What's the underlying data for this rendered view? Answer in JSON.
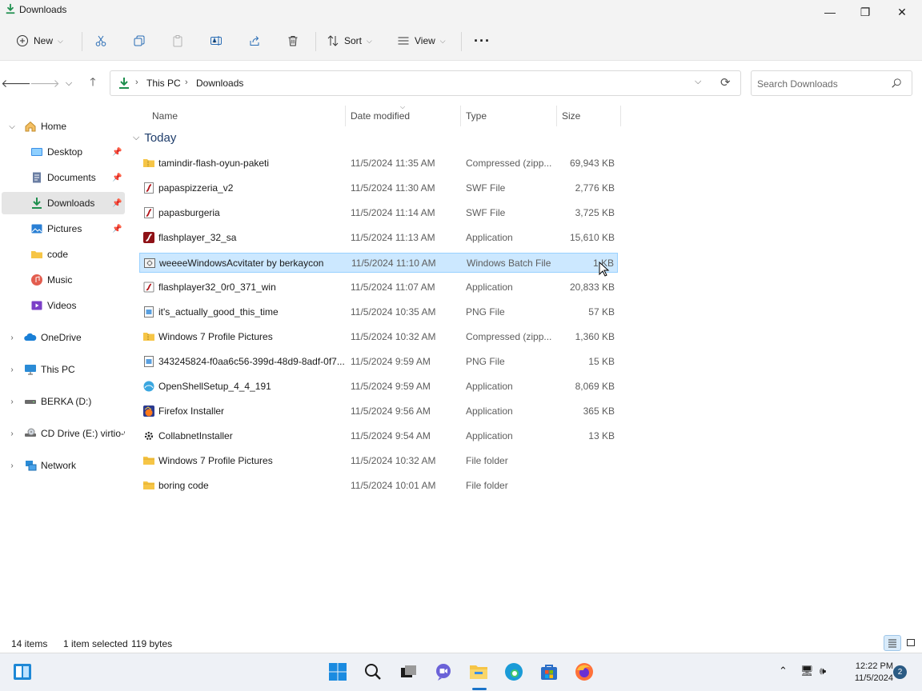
{
  "window": {
    "title": "Downloads",
    "controls": {
      "minimize": "—",
      "maximize": "❐",
      "close": "✕"
    }
  },
  "toolbar": {
    "new_label": "New",
    "sort_label": "Sort",
    "view_label": "View",
    "more_label": "···",
    "icons": [
      "cut-icon",
      "copy-icon",
      "paste-icon",
      "rename-icon",
      "share-icon",
      "delete-icon"
    ]
  },
  "address": {
    "crumbs": [
      "This PC",
      "Downloads"
    ],
    "separator": "›"
  },
  "search": {
    "placeholder": "Search Downloads"
  },
  "sidebar": {
    "items": [
      {
        "label": "Home",
        "icon": "home-icon",
        "chevron": "expanded"
      },
      {
        "label": "Desktop",
        "icon": "desktop-icon",
        "pinned": true
      },
      {
        "label": "Documents",
        "icon": "documents-icon",
        "pinned": true
      },
      {
        "label": "Downloads",
        "icon": "download-icon",
        "pinned": true,
        "selected": true
      },
      {
        "label": "Pictures",
        "icon": "pictures-icon",
        "pinned": true
      },
      {
        "label": "code",
        "icon": "folder-icon"
      },
      {
        "label": "Music",
        "icon": "music-icon"
      },
      {
        "label": "Videos",
        "icon": "videos-icon"
      },
      {
        "label": "OneDrive",
        "icon": "onedrive-icon",
        "chevron": "collapsed"
      },
      {
        "label": "This PC",
        "icon": "this-pc-icon",
        "chevron": "collapsed"
      },
      {
        "label": "BERKA (D:)",
        "icon": "drive-icon",
        "chevron": "collapsed"
      },
      {
        "label": "CD Drive (E:) virtio-w",
        "icon": "cd-drive-icon",
        "chevron": "collapsed"
      },
      {
        "label": "Network",
        "icon": "network-icon",
        "chevron": "collapsed"
      }
    ]
  },
  "columns": {
    "name": "Name",
    "date": "Date modified",
    "type": "Type",
    "size": "Size"
  },
  "group": {
    "label": "Today"
  },
  "files": [
    {
      "name": "tamindir-flash-oyun-paketi",
      "date": "11/5/2024 11:35 AM",
      "type": "Compressed (zipp...",
      "size": "69,943 KB",
      "icon": "zip-folder-icon"
    },
    {
      "name": "papaspizzeria_v2",
      "date": "11/5/2024 11:30 AM",
      "type": "SWF File",
      "size": "2,776 KB",
      "icon": "swf-file-icon"
    },
    {
      "name": "papasburgeria",
      "date": "11/5/2024 11:14 AM",
      "type": "SWF File",
      "size": "3,725 KB",
      "icon": "swf-file-icon"
    },
    {
      "name": "flashplayer_32_sa",
      "date": "11/5/2024 11:13 AM",
      "type": "Application",
      "size": "15,610 KB",
      "icon": "flash-app-icon"
    },
    {
      "name": "weeeeWindowsAcvitater by berkaycon",
      "date": "11/5/2024 11:10 AM",
      "type": "Windows Batch File",
      "size": "1 KB",
      "icon": "batch-file-icon",
      "selected": true
    },
    {
      "name": "flashplayer32_0r0_371_win",
      "date": "11/5/2024 11:07 AM",
      "type": "Application",
      "size": "20,833 KB",
      "icon": "flash-app-icon"
    },
    {
      "name": "it's_actually_good_this_time",
      "date": "11/5/2024 10:35 AM",
      "type": "PNG File",
      "size": "57 KB",
      "icon": "png-file-icon"
    },
    {
      "name": "Windows 7 Profile Pictures",
      "date": "11/5/2024 10:32 AM",
      "type": "Compressed (zipp...",
      "size": "1,360 KB",
      "icon": "zip-folder-icon"
    },
    {
      "name": "343245824-f0aa6c56-399d-48d9-8adf-0f7...",
      "date": "11/5/2024 9:59 AM",
      "type": "PNG File",
      "size": "15 KB",
      "icon": "png-file-icon"
    },
    {
      "name": "OpenShellSetup_4_4_191",
      "date": "11/5/2024 9:59 AM",
      "type": "Application",
      "size": "8,069 KB",
      "icon": "openshell-icon"
    },
    {
      "name": "Firefox Installer",
      "date": "11/5/2024 9:56 AM",
      "type": "Application",
      "size": "365 KB",
      "icon": "firefox-installer-icon"
    },
    {
      "name": "CollabnetInstaller",
      "date": "11/5/2024 9:54 AM",
      "type": "Application",
      "size": "13 KB",
      "icon": "installer-icon"
    },
    {
      "name": "Windows 7 Profile Pictures",
      "date": "11/5/2024 10:32 AM",
      "type": "File folder",
      "size": "",
      "icon": "folder-icon"
    },
    {
      "name": "boring code",
      "date": "11/5/2024 10:01 AM",
      "type": "File folder",
      "size": "",
      "icon": "folder-icon"
    }
  ],
  "status": {
    "count": "14 items",
    "selection": "1 item selected",
    "bytes": "119 bytes"
  },
  "taskbar": {
    "time": "12:22 PM",
    "date": "11/5/2024",
    "notifications": "2",
    "apps": [
      "widgets-icon",
      "start-icon",
      "search-icon",
      "task-view-icon",
      "chat-icon",
      "file-explorer-icon",
      "edge-icon",
      "store-icon",
      "firefox-icon"
    ]
  },
  "colors": {
    "accent": "#0067c0",
    "selection_bg": "#cce8ff",
    "selection_border": "#99d1ff",
    "chrome_bg": "#f3f3f3",
    "group_header": "#1f3d6b"
  }
}
